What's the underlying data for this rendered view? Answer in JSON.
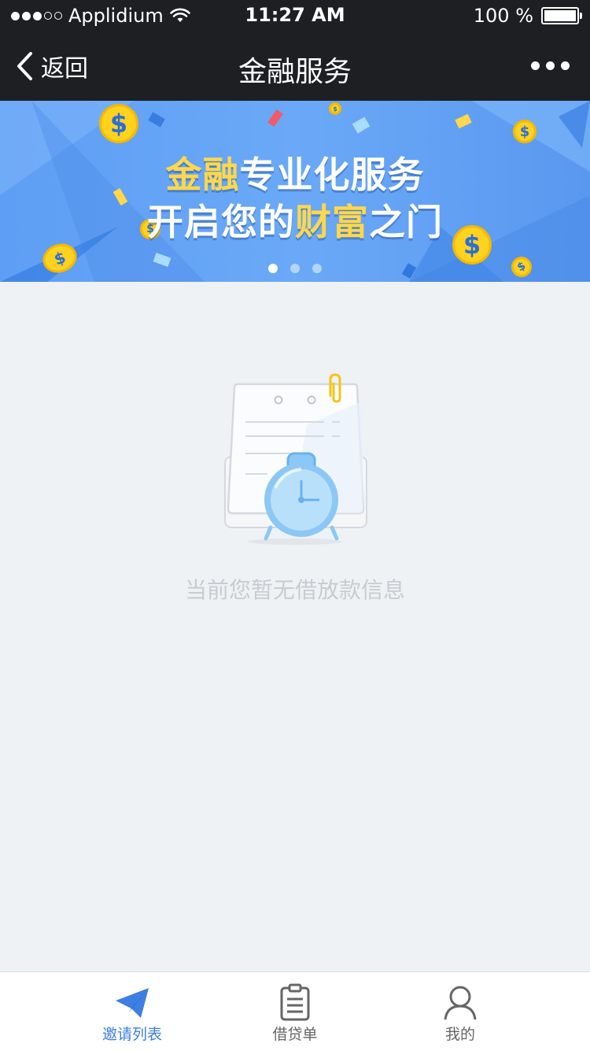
{
  "status_bar": {
    "carrier": "Applidium",
    "time": "11:27 AM",
    "battery": "100 %"
  },
  "nav": {
    "back_label": "返回",
    "title": "金融服务"
  },
  "banner": {
    "line1_highlight": "金融",
    "line1_rest": "专业化服务",
    "line2_pre": "开启您的",
    "line2_highlight": "财富",
    "line2_post": "之门",
    "coin_symbol": "$",
    "slides": 3,
    "active_slide": 1
  },
  "empty_state": {
    "message": "当前您暂无借放款信息"
  },
  "tab_bar": {
    "tabs": [
      {
        "label": "邀请列表",
        "icon": "paper-plane-icon",
        "active": true
      },
      {
        "label": "借贷单",
        "icon": "clipboard-icon",
        "active": false
      },
      {
        "label": "我的",
        "icon": "user-icon",
        "active": false
      }
    ]
  },
  "colors": {
    "nav_bg": "#1e1f23",
    "accent": "#3d7fe2",
    "banner_blue": "#6aa9f7",
    "gold": "#ffd84a",
    "page_bg": "#eff2f5"
  }
}
